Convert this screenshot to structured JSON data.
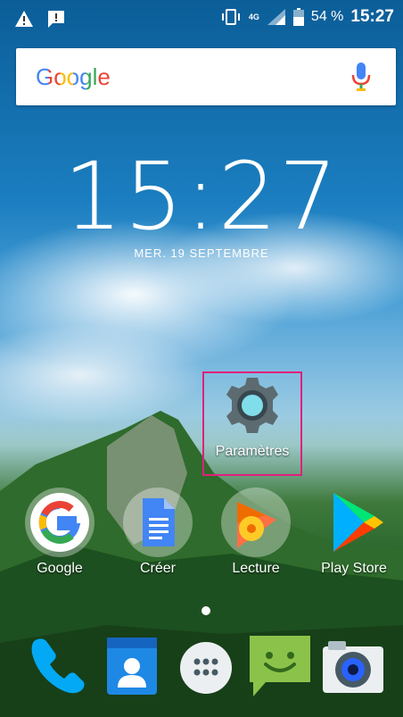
{
  "status_bar": {
    "network_label": "4G",
    "battery_percent": "54 %",
    "time": "15:27"
  },
  "search": {
    "logo": "Google"
  },
  "clock": {
    "time": "15:27",
    "date": "MER. 19 SEPTEMBRE"
  },
  "apps": {
    "settings": "Paramètres",
    "google": "Google",
    "creer": "Créer",
    "lecture": "Lecture",
    "play_store": "Play Store"
  },
  "colors": {
    "highlight": "#e0207c",
    "google_blue": "#4285F4",
    "google_red": "#EA4335",
    "google_yellow": "#FBBC05",
    "google_green": "#34A853"
  },
  "icons": [
    "warning-icon",
    "message-icon",
    "vibrate-icon",
    "signal-icon",
    "battery-icon",
    "mic-icon",
    "settings-gear-icon",
    "google-g-icon",
    "docs-icon",
    "play-music-icon",
    "play-store-icon",
    "phone-icon",
    "contacts-icon",
    "app-drawer-icon",
    "messaging-icon",
    "camera-icon"
  ]
}
